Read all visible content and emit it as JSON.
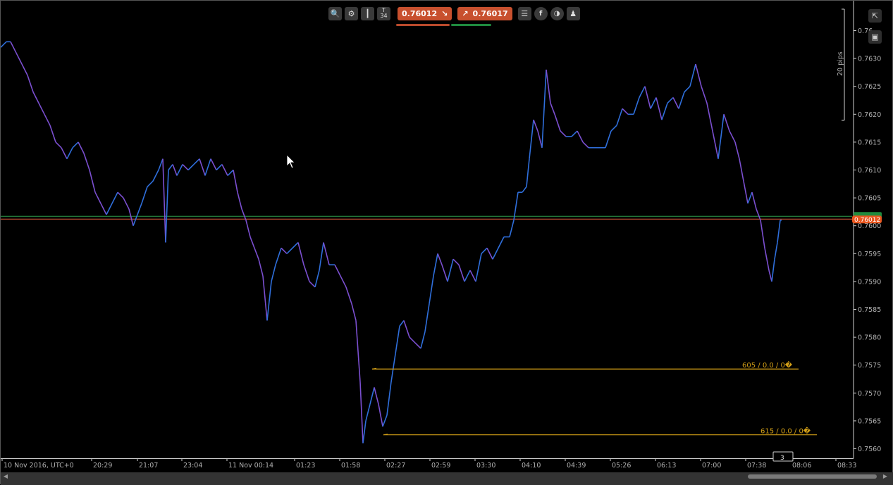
{
  "toolbar": {
    "icons": [
      "zoom-icon",
      "chart-settings-icon",
      "chart-type-icon",
      "timeframe-icon"
    ],
    "timeframe_label": "T\n34",
    "sell_price": "0.76012",
    "buy_price": "0.76017",
    "right_icons": [
      "order-list-icon",
      "facebook-icon",
      "social-icon",
      "trader-icon"
    ]
  },
  "side_icons": [
    "detach-icon",
    "screenshot-icon"
  ],
  "colors": {
    "background": "#000000",
    "line_blue": "#2f6fdc",
    "line_purple": "#7b4fd0",
    "bid_line": "#e05a3a",
    "ask_line": "#2e9e4a",
    "order_line": "#d4a017",
    "price_badge": "#e8561f",
    "axis_text": "#b0b0b0"
  },
  "chart_data": {
    "type": "line",
    "title": "",
    "xlabel": "",
    "ylabel": "",
    "symbol_price_current": 0.76012,
    "ask_price_current": 0.76017,
    "ylim": [
      0.75585,
      0.7635
    ],
    "y_ticks": [
      "0.76",
      "0.7630",
      "0.7625",
      "0.7620",
      "0.7615",
      "0.7610",
      "0.7605",
      "0.7600",
      "0.7595",
      "0.7590",
      "0.7585",
      "0.7580",
      "0.7575",
      "0.7570",
      "0.7565",
      "0.7560"
    ],
    "y_tick_values": [
      0.7635,
      0.763,
      0.7625,
      0.762,
      0.7615,
      0.761,
      0.7605,
      0.76,
      0.7595,
      0.759,
      0.7585,
      0.758,
      0.7575,
      0.757,
      0.7565,
      0.756
    ],
    "x_ticks": [
      "10 Nov 2016, UTC+0",
      "20:29",
      "21:07",
      "23:04",
      "11 Nov 00:14",
      "01:23",
      "01:58",
      "02:27",
      "02:59",
      "03:30",
      "04:10",
      "04:39",
      "05:26",
      "06:13",
      "07:00",
      "07:38",
      "08:06",
      "08:33"
    ],
    "pips_scale_label": "20 pips",
    "price_badge": "0.76012",
    "candle_countdown": "3",
    "series": [
      {
        "points": [
          [
            0,
            0.7632
          ],
          [
            8,
            0.7633
          ],
          [
            14,
            0.7633
          ],
          [
            22,
            0.7631
          ],
          [
            30,
            0.7629
          ],
          [
            38,
            0.7627
          ],
          [
            46,
            0.7624
          ],
          [
            54,
            0.7622
          ],
          [
            62,
            0.762
          ],
          [
            70,
            0.7618
          ],
          [
            78,
            0.7615
          ],
          [
            86,
            0.7614
          ],
          [
            94,
            0.7612
          ],
          [
            102,
            0.7614
          ],
          [
            110,
            0.7615
          ],
          [
            118,
            0.7613
          ],
          [
            126,
            0.761
          ],
          [
            134,
            0.7606
          ],
          [
            142,
            0.7604
          ],
          [
            150,
            0.7602
          ],
          [
            158,
            0.7604
          ],
          [
            166,
            0.7606
          ],
          [
            174,
            0.7605
          ],
          [
            182,
            0.7603
          ],
          [
            188,
            0.76
          ],
          [
            194,
            0.7602
          ],
          [
            200,
            0.7604
          ],
          [
            208,
            0.7607
          ],
          [
            216,
            0.7608
          ],
          [
            224,
            0.761
          ],
          [
            230,
            0.7612
          ],
          [
            234,
            0.7597
          ],
          [
            238,
            0.761
          ],
          [
            244,
            0.7611
          ],
          [
            250,
            0.7609
          ],
          [
            258,
            0.7611
          ],
          [
            266,
            0.761
          ],
          [
            274,
            0.7611
          ],
          [
            282,
            0.7612
          ],
          [
            290,
            0.7609
          ],
          [
            298,
            0.7612
          ],
          [
            306,
            0.761
          ],
          [
            314,
            0.7611
          ],
          [
            322,
            0.7609
          ],
          [
            330,
            0.761
          ],
          [
            336,
            0.7606
          ],
          [
            342,
            0.7603
          ],
          [
            348,
            0.7601
          ],
          [
            354,
            0.7598
          ],
          [
            360,
            0.7596
          ],
          [
            366,
            0.7594
          ],
          [
            372,
            0.7591
          ],
          [
            378,
            0.7583
          ],
          [
            384,
            0.759
          ],
          [
            390,
            0.7593
          ],
          [
            398,
            0.7596
          ],
          [
            406,
            0.7595
          ],
          [
            414,
            0.7596
          ],
          [
            422,
            0.7597
          ],
          [
            430,
            0.7593
          ],
          [
            438,
            0.759
          ],
          [
            446,
            0.7589
          ],
          [
            452,
            0.7592
          ],
          [
            458,
            0.7597
          ],
          [
            466,
            0.7593
          ],
          [
            474,
            0.7593
          ],
          [
            482,
            0.7591
          ],
          [
            490,
            0.7589
          ],
          [
            498,
            0.7586
          ],
          [
            504,
            0.7583
          ],
          [
            510,
            0.7572
          ],
          [
            514,
            0.7561
          ],
          [
            518,
            0.7565
          ],
          [
            524,
            0.7568
          ],
          [
            530,
            0.7571
          ],
          [
            536,
            0.7568
          ],
          [
            542,
            0.7564
          ],
          [
            548,
            0.7566
          ],
          [
            554,
            0.7572
          ],
          [
            560,
            0.7577
          ],
          [
            566,
            0.7582
          ],
          [
            572,
            0.7583
          ],
          [
            580,
            0.758
          ],
          [
            588,
            0.7579
          ],
          [
            596,
            0.7578
          ],
          [
            602,
            0.7581
          ],
          [
            608,
            0.7586
          ],
          [
            614,
            0.7591
          ],
          [
            620,
            0.7595
          ],
          [
            626,
            0.7593
          ],
          [
            634,
            0.759
          ],
          [
            642,
            0.7594
          ],
          [
            650,
            0.7593
          ],
          [
            658,
            0.759
          ],
          [
            666,
            0.7592
          ],
          [
            674,
            0.759
          ],
          [
            682,
            0.7595
          ],
          [
            690,
            0.7596
          ],
          [
            698,
            0.7594
          ],
          [
            706,
            0.7596
          ],
          [
            714,
            0.7598
          ],
          [
            722,
            0.7598
          ],
          [
            728,
            0.7601
          ],
          [
            734,
            0.7606
          ],
          [
            740,
            0.7606
          ],
          [
            746,
            0.7607
          ],
          [
            750,
            0.7612
          ],
          [
            756,
            0.7619
          ],
          [
            762,
            0.7617
          ],
          [
            768,
            0.7614
          ],
          [
            774,
            0.7628
          ],
          [
            780,
            0.7622
          ],
          [
            786,
            0.762
          ],
          [
            794,
            0.7617
          ],
          [
            802,
            0.7616
          ],
          [
            810,
            0.7616
          ],
          [
            818,
            0.7617
          ],
          [
            826,
            0.7615
          ],
          [
            834,
            0.7614
          ],
          [
            842,
            0.7614
          ],
          [
            850,
            0.7614
          ],
          [
            858,
            0.7614
          ],
          [
            866,
            0.7617
          ],
          [
            874,
            0.7618
          ],
          [
            882,
            0.7621
          ],
          [
            890,
            0.762
          ],
          [
            898,
            0.762
          ],
          [
            906,
            0.7623
          ],
          [
            914,
            0.7625
          ],
          [
            922,
            0.7621
          ],
          [
            930,
            0.7623
          ],
          [
            938,
            0.7619
          ],
          [
            946,
            0.7622
          ],
          [
            954,
            0.7623
          ],
          [
            962,
            0.7621
          ],
          [
            970,
            0.7624
          ],
          [
            978,
            0.7625
          ],
          [
            986,
            0.7629
          ],
          [
            994,
            0.7625
          ],
          [
            1002,
            0.7622
          ],
          [
            1010,
            0.7617
          ],
          [
            1018,
            0.7612
          ],
          [
            1026,
            0.762
          ],
          [
            1034,
            0.7617
          ],
          [
            1042,
            0.7615
          ],
          [
            1048,
            0.7612
          ],
          [
            1054,
            0.7608
          ],
          [
            1060,
            0.7604
          ],
          [
            1066,
            0.7606
          ],
          [
            1072,
            0.7603
          ],
          [
            1078,
            0.7601
          ],
          [
            1084,
            0.7596
          ],
          [
            1090,
            0.7592
          ],
          [
            1094,
            0.759
          ],
          [
            1098,
            0.7594
          ],
          [
            1102,
            0.7597
          ],
          [
            1106,
            0.7601
          ],
          [
            1108,
            0.7601
          ]
        ]
      }
    ],
    "horizontal_lines": [
      {
        "price": 0.76017,
        "color_key": "ask_line",
        "style": "solid"
      },
      {
        "price": 0.76012,
        "color_key": "bid_line",
        "style": "solid"
      }
    ],
    "orders": [
      {
        "price": 0.75743,
        "label": "605 / 0.0 / 0�",
        "start_x": 527
      },
      {
        "price": 0.75625,
        "label": "615 / 0.0 / 0�",
        "start_x": 543
      }
    ]
  }
}
